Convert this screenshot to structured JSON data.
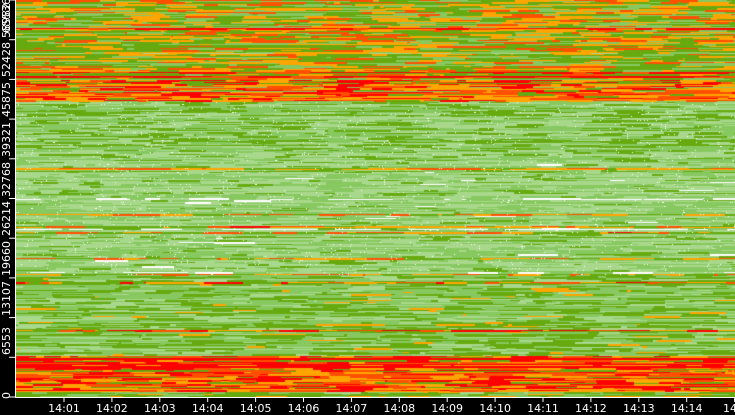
{
  "chart_data": {
    "type": "heatmap",
    "title": "",
    "xlabel": "",
    "ylabel": "",
    "ylim": [
      0,
      65536
    ],
    "yticks": [
      "0",
      "6553",
      "13107",
      "19660",
      "26214",
      "32768",
      "39321",
      "45875",
      "52428",
      "58982",
      "65536"
    ],
    "xticks": [
      "14:01",
      "14:02",
      "14:03",
      "14:04",
      "14:05",
      "14:06",
      "14:07",
      "14:08",
      "14:09",
      "14:10",
      "14:11",
      "14:12",
      "14:13",
      "14:14",
      "14"
    ],
    "xlim_minutes": [
      0.0,
      15.0
    ],
    "colorscale": [
      "#ffffff",
      "#a8d88c",
      "#88c860",
      "#66aa10",
      "#ffa500",
      "#ff5000",
      "#ff0000"
    ],
    "bands": [
      {
        "y_from": 52428,
        "y_to": 65536,
        "heat": 0.55
      },
      {
        "y_from": 49000,
        "y_to": 52428,
        "heat": 0.8
      },
      {
        "y_from": 40000,
        "y_to": 49000,
        "heat": 0.25
      },
      {
        "y_from": 20000,
        "y_to": 40000,
        "heat": 0.12
      },
      {
        "y_from": 7000,
        "y_to": 20000,
        "heat": 0.3
      },
      {
        "y_from": 1000,
        "y_to": 7000,
        "heat": 0.85
      },
      {
        "y_from": 0,
        "y_to": 1000,
        "heat": 0.4
      }
    ]
  }
}
